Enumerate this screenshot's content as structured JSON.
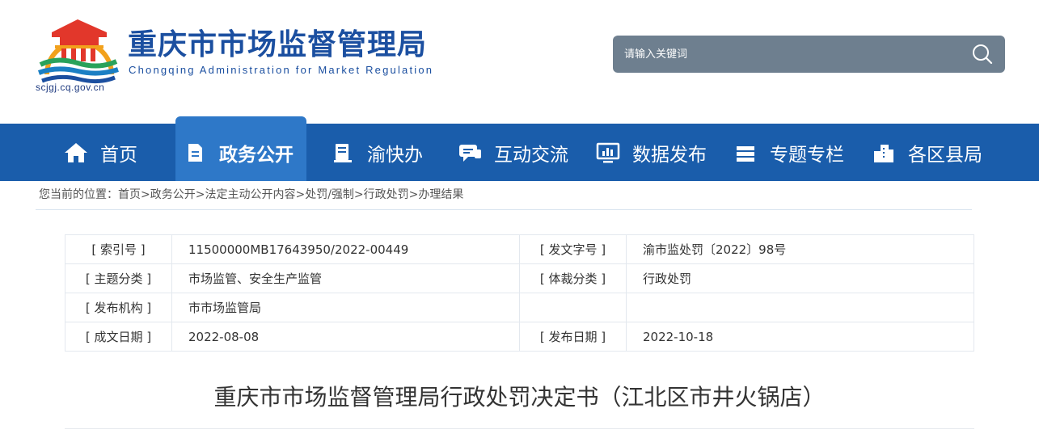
{
  "header": {
    "site_title": "重庆市市场监督管理局",
    "site_subtitle": "Chongqing  Administration for Market Regulation",
    "logo_url": "scjgj.cq.gov.cn",
    "search": {
      "placeholder": "请输入关键词"
    }
  },
  "nav": {
    "items": [
      {
        "label": "首页",
        "icon": "home-icon"
      },
      {
        "label": "政务公开",
        "icon": "document-icon"
      },
      {
        "label": "渝快办",
        "icon": "book-icon"
      },
      {
        "label": "互动交流",
        "icon": "chat-icon"
      },
      {
        "label": "数据发布",
        "icon": "monitor-chart-icon"
      },
      {
        "label": "专题专栏",
        "icon": "stack-icon"
      },
      {
        "label": "各区县局",
        "icon": "buildings-icon"
      }
    ],
    "active_index": 1
  },
  "breadcrumb": {
    "prefix": "您当前的位置：",
    "items": [
      "首页",
      "政务公开",
      "法定主动公开内容",
      "处罚/强制",
      "行政处罚",
      "办理结果"
    ],
    "separator": ">"
  },
  "meta": {
    "rows": [
      {
        "label1": "[ 索引号 ]",
        "value1": "11500000MB17643950/2022-00449",
        "label2": "[ 发文字号 ]",
        "value2": "渝市监处罚〔2022〕98号"
      },
      {
        "label1": "[ 主题分类 ]",
        "value1": "市场监管、安全生产监管",
        "label2": "[ 体裁分类 ]",
        "value2": "行政处罚"
      },
      {
        "label1": "[ 发布机构 ]",
        "value1": "市市场监管局",
        "label2": "",
        "value2": ""
      },
      {
        "label1": "[ 成文日期 ]",
        "value1": "2022-08-08",
        "label2": "[ 发布日期 ]",
        "value2": "2022-10-18"
      }
    ]
  },
  "document": {
    "title": "重庆市市场监督管理局行政处罚决定书（江北区市井火锅店）"
  },
  "colors": {
    "nav_bg": "#1a5dab",
    "nav_active_bg": "#2e78c8",
    "brand_text": "#1b4fa0",
    "search_bg": "#6e7f8f"
  }
}
